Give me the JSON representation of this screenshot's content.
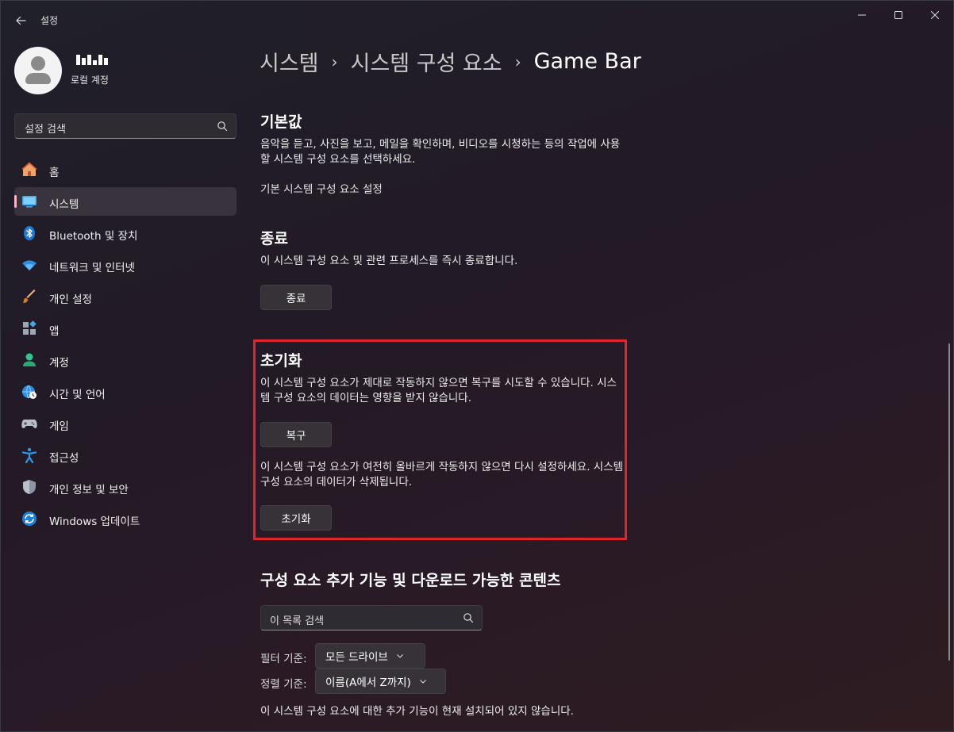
{
  "window": {
    "title": "설정",
    "back_icon": "arrow-left-icon",
    "controls": [
      "minimize-icon",
      "maximize-icon",
      "close-icon"
    ]
  },
  "profile": {
    "account_type": "로컬 계정"
  },
  "search": {
    "placeholder": "설정 검색"
  },
  "sidebar": {
    "items": [
      {
        "label": "홈",
        "icon": "home-icon",
        "active": false
      },
      {
        "label": "시스템",
        "icon": "system-icon",
        "active": true
      },
      {
        "label": "Bluetooth 및 장치",
        "icon": "bluetooth-icon",
        "active": false
      },
      {
        "label": "네트워크 및 인터넷",
        "icon": "wifi-icon",
        "active": false
      },
      {
        "label": "개인 설정",
        "icon": "brush-icon",
        "active": false
      },
      {
        "label": "앱",
        "icon": "apps-icon",
        "active": false
      },
      {
        "label": "계정",
        "icon": "account-icon",
        "active": false
      },
      {
        "label": "시간 및 언어",
        "icon": "globe-clock-icon",
        "active": false
      },
      {
        "label": "게임",
        "icon": "gamepad-icon",
        "active": false
      },
      {
        "label": "접근성",
        "icon": "accessibility-icon",
        "active": false
      },
      {
        "label": "개인 정보 및 보안",
        "icon": "shield-icon",
        "active": false
      },
      {
        "label": "Windows 업데이트",
        "icon": "update-icon",
        "active": false
      }
    ]
  },
  "breadcrumb": {
    "level1": "시스템",
    "level2": "시스템 구성 요소",
    "current": "Game Bar",
    "separator": "›"
  },
  "defaults": {
    "title": "기본값",
    "description": "음악을 듣고, 사진을 보고, 메일을 확인하며, 비디오를 시청하는 등의 작업에 사용할 시스템 구성 요소를 선택하세요.",
    "link": "기본 시스템 구성 요소 설정"
  },
  "terminate": {
    "title": "종료",
    "description": "이 시스템 구성 요소 및 관련 프로세스를 즉시 종료합니다.",
    "button": "종료"
  },
  "reset": {
    "title": "초기화",
    "repair_description": "이 시스템 구성 요소가 제대로 작동하지 않으면 복구를 시도할 수 있습니다. 시스템 구성 요소의 데이터는 영향을 받지 않습니다.",
    "repair_button": "복구",
    "reset_description": "이 시스템 구성 요소가 여전히 올바르게 작동하지 않으면 다시 설정하세요. 시스템 구성 요소의 데이터가 삭제됩니다.",
    "reset_button": "초기화",
    "highlight_color": "#e0262d"
  },
  "addons": {
    "title": "구성 요소 추가 기능 및 다운로드 가능한 콘텐츠",
    "search_placeholder": "이 목록 검색",
    "filter_label": "필터 기준:",
    "filter_value": "모든 드라이브",
    "sort_label": "정렬 기준:",
    "sort_value": "이름(A에서 Z까지)",
    "status": "이 시스템 구성 요소에 대한 추가 기능이 현재 설치되어 있지 않습니다."
  },
  "colors": {
    "accent": "#ffb3c8",
    "highlight": "#e0262d"
  }
}
